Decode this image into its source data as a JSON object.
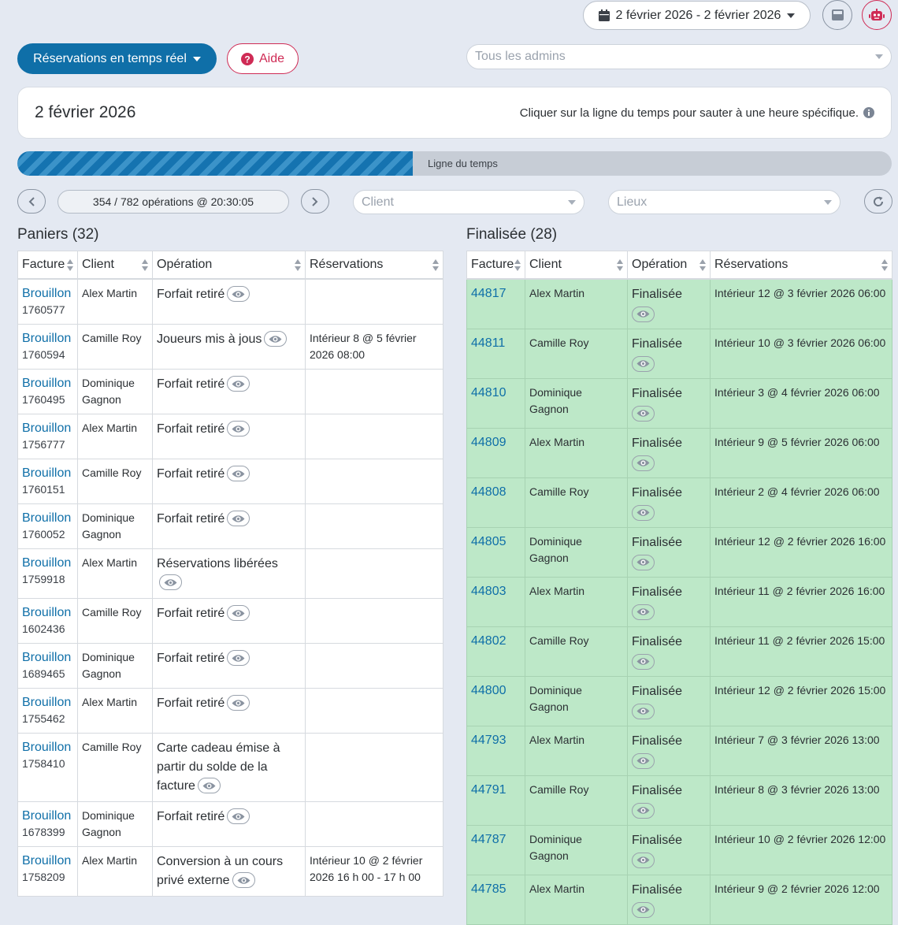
{
  "header": {
    "date_range": "2 février 2026 - 2 février 2026",
    "mode_button": "Réservations en temps réel",
    "help_button": "Aide",
    "admins_placeholder": "Tous les admins"
  },
  "day_card": {
    "title": "2 février 2026",
    "hint": "Cliquer sur la ligne du temps pour sauter à une heure spécifique."
  },
  "timeline": {
    "label": "Ligne du temps",
    "progress": 0.452
  },
  "controls": {
    "ops_status": "354 / 782 opérations @ 20:30:05",
    "client_placeholder": "Client",
    "lieux_placeholder": "Lieux"
  },
  "paniers": {
    "title": "Paniers (32)",
    "columns": [
      "Facture",
      "Client",
      "Opération",
      "Réservations"
    ],
    "rows": [
      {
        "status": "Brouillon",
        "id": "1760577",
        "client": "Alex Martin",
        "operation": "Forfait retiré",
        "reservation": ""
      },
      {
        "status": "Brouillon",
        "id": "1760594",
        "client": "Camille Roy",
        "operation": "Joueurs mis à jous",
        "reservation": "Intérieur 8 @ 5 février 2026 08:00"
      },
      {
        "status": "Brouillon",
        "id": "1760495",
        "client": "Dominique Gagnon",
        "operation": "Forfait retiré",
        "reservation": ""
      },
      {
        "status": "Brouillon",
        "id": "1756777",
        "client": "Alex Martin",
        "operation": "Forfait retiré",
        "reservation": ""
      },
      {
        "status": "Brouillon",
        "id": "1760151",
        "client": "Camille Roy",
        "operation": "Forfait retiré",
        "reservation": ""
      },
      {
        "status": "Brouillon",
        "id": "1760052",
        "client": "Dominique Gagnon",
        "operation": "Forfait retiré",
        "reservation": ""
      },
      {
        "status": "Brouillon",
        "id": "1759918",
        "client": "Alex Martin",
        "operation": "Réservations libérées",
        "reservation": ""
      },
      {
        "status": "Brouillon",
        "id": "1602436",
        "client": "Camille Roy",
        "operation": "Forfait retiré",
        "reservation": ""
      },
      {
        "status": "Brouillon",
        "id": "1689465",
        "client": "Dominique Gagnon",
        "operation": "Forfait retiré",
        "reservation": ""
      },
      {
        "status": "Brouillon",
        "id": "1755462",
        "client": "Alex Martin",
        "operation": "Forfait retiré",
        "reservation": ""
      },
      {
        "status": "Brouillon",
        "id": "1758410",
        "client": "Camille Roy",
        "operation": "Carte cadeau émise à partir du solde de la facture",
        "reservation": ""
      },
      {
        "status": "Brouillon",
        "id": "1678399",
        "client": "Dominique Gagnon",
        "operation": "Forfait retiré",
        "reservation": ""
      },
      {
        "status": "Brouillon",
        "id": "1758209",
        "client": "Alex Martin",
        "operation": "Conversion à un cours privé externe",
        "reservation": "Intérieur 10 @ 2 février 2026 16 h 00 - 17 h 00"
      }
    ]
  },
  "finalisee": {
    "title": "Finalisée (28)",
    "columns": [
      "Facture",
      "Client",
      "Opération",
      "Réservations"
    ],
    "rows": [
      {
        "id": "44817",
        "client": "Alex Martin",
        "operation": "Finalisée",
        "reservation": "Intérieur 12 @ 3 février 2026 06:00"
      },
      {
        "id": "44811",
        "client": "Camille Roy",
        "operation": "Finalisée",
        "reservation": "Intérieur 10 @ 3 février 2026 06:00"
      },
      {
        "id": "44810",
        "client": "Dominique Gagnon",
        "operation": "Finalisée",
        "reservation": "Intérieur 3 @ 4 février 2026 06:00"
      },
      {
        "id": "44809",
        "client": "Alex Martin",
        "operation": "Finalisée",
        "reservation": "Intérieur 9 @ 5 février 2026 06:00"
      },
      {
        "id": "44808",
        "client": "Camille Roy",
        "operation": "Finalisée",
        "reservation": "Intérieur 2 @ 4 février 2026 06:00"
      },
      {
        "id": "44805",
        "client": "Dominique Gagnon",
        "operation": "Finalisée",
        "reservation": "Intérieur 12 @ 2 février 2026 16:00"
      },
      {
        "id": "44803",
        "client": "Alex Martin",
        "operation": "Finalisée",
        "reservation": "Intérieur 11 @ 2 février 2026 16:00"
      },
      {
        "id": "44802",
        "client": "Camille Roy",
        "operation": "Finalisée",
        "reservation": "Intérieur 11 @ 2 février 2026 15:00"
      },
      {
        "id": "44800",
        "client": "Dominique Gagnon",
        "operation": "Finalisée",
        "reservation": "Intérieur 12 @ 2 février 2026 15:00"
      },
      {
        "id": "44793",
        "client": "Alex Martin",
        "operation": "Finalisée",
        "reservation": "Intérieur 7 @ 3 février 2026 13:00"
      },
      {
        "id": "44791",
        "client": "Camille Roy",
        "operation": "Finalisée",
        "reservation": "Intérieur 8 @ 3 février 2026 13:00"
      },
      {
        "id": "44787",
        "client": "Dominique Gagnon",
        "operation": "Finalisée",
        "reservation": "Intérieur 10 @ 2 février 2026 12:00"
      },
      {
        "id": "44785",
        "client": "Alex Martin",
        "operation": "Finalisée",
        "reservation": "Intérieur 9 @ 2 février 2026 12:00"
      }
    ]
  },
  "colors": {
    "primary": "#0f6fa8",
    "danger": "#cf2b55",
    "finalized_row": "#bde8c8",
    "page_bg": "#e4e9f2"
  }
}
